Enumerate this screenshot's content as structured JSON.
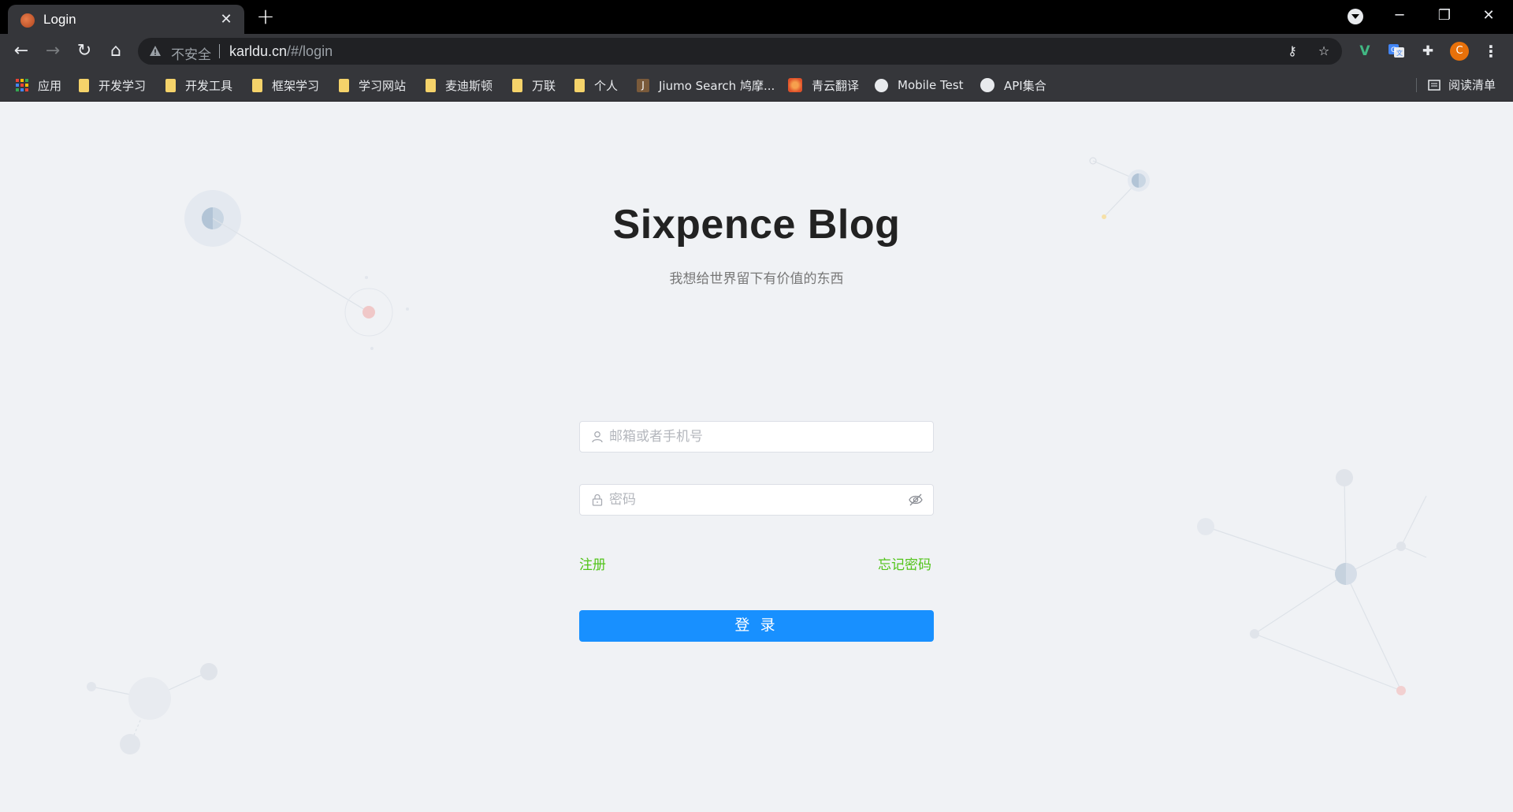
{
  "browser": {
    "tab": {
      "title": "Login"
    },
    "omnibox": {
      "security_label": "不安全",
      "url_host": "karldu.cn",
      "url_path": "/#/login"
    },
    "profile_initial": "C"
  },
  "bookmarks": [
    {
      "label": "应用",
      "icon": "apps-grid-icon"
    },
    {
      "label": "开发学习",
      "icon": "folder-icon"
    },
    {
      "label": "开发工具",
      "icon": "folder-icon"
    },
    {
      "label": "框架学习",
      "icon": "folder-icon"
    },
    {
      "label": "学习网站",
      "icon": "folder-icon"
    },
    {
      "label": "麦迪斯顿",
      "icon": "folder-icon"
    },
    {
      "label": "万联",
      "icon": "folder-icon"
    },
    {
      "label": "个人",
      "icon": "folder-icon"
    },
    {
      "label": "Jiumo Search 鸠摩...",
      "icon": "j-icon"
    },
    {
      "label": "青云翻译",
      "icon": "qingyun-icon"
    },
    {
      "label": "Mobile Test",
      "icon": "globe-icon"
    },
    {
      "label": "API集合",
      "icon": "github-icon"
    }
  ],
  "reading_list": "阅读清单",
  "login": {
    "title": "Sixpence Blog",
    "subtitle": "我想给世界留下有价值的东西",
    "username_placeholder": "邮箱或者手机号",
    "password_placeholder": "密码",
    "register_label": "注册",
    "forgot_label": "忘记密码",
    "submit_label": "登 录"
  },
  "colors": {
    "primary": "#1890ff",
    "link": "#52c41a",
    "background": "#f0f2f5"
  }
}
